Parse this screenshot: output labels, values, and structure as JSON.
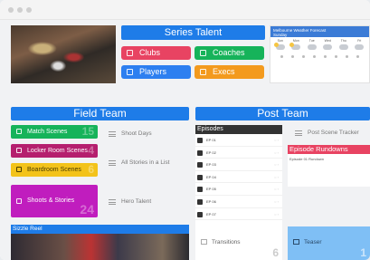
{
  "window": {
    "controls": [
      "close",
      "minimize",
      "maximize"
    ]
  },
  "top": {
    "series_talent": "Series Talent",
    "buttons": [
      {
        "label": "Clubs",
        "color": "#e84362"
      },
      {
        "label": "Coaches",
        "color": "#16b35a"
      },
      {
        "label": "Players",
        "color": "#2d7ff0"
      },
      {
        "label": "Execs",
        "color": "#f39a1e"
      }
    ],
    "weather": {
      "title": "Melbourne Weather Forecast",
      "subtitle": "Sunday",
      "days": [
        "Sun",
        "Mon",
        "Tue",
        "Wed",
        "Thu",
        "Fri"
      ]
    }
  },
  "field_team": {
    "title": "Field Team",
    "cards": [
      {
        "label": "Match Scenes",
        "count": "15",
        "color": "#16b35a"
      },
      {
        "label": "Locker Room Scenes",
        "count": "4",
        "color": "#b51f6e"
      },
      {
        "label": "Boardroom Scenes",
        "count": "6",
        "color": "#f3c31a"
      },
      {
        "label": "Shoots & Stories",
        "count": "24",
        "color": "#c01dbe"
      }
    ],
    "links": [
      "Shoot Days",
      "All Stories in a List",
      "Hero Talent"
    ],
    "sizzle_reel": "Sizzle Reel"
  },
  "post_team": {
    "title": "Post Team",
    "episodes_title": "Episodes",
    "episodes": [
      "EP 01",
      "EP 02",
      "EP 03",
      "EP 04",
      "EP 05",
      "EP 06",
      "EP 07"
    ],
    "tracker": "Post Scene Tracker",
    "rundowns_title": "Episode Rundowns",
    "rundown_item": "Episode 01 Rundown",
    "transitions": "Transitions",
    "transitions_count": "6",
    "teaser": "Teaser",
    "teaser_count": "1"
  },
  "colors": {
    "header_blue": "#1e7ce8",
    "dark": "#333333",
    "rundown_pink": "#e84362",
    "teaser_blue": "#7fbff5"
  }
}
